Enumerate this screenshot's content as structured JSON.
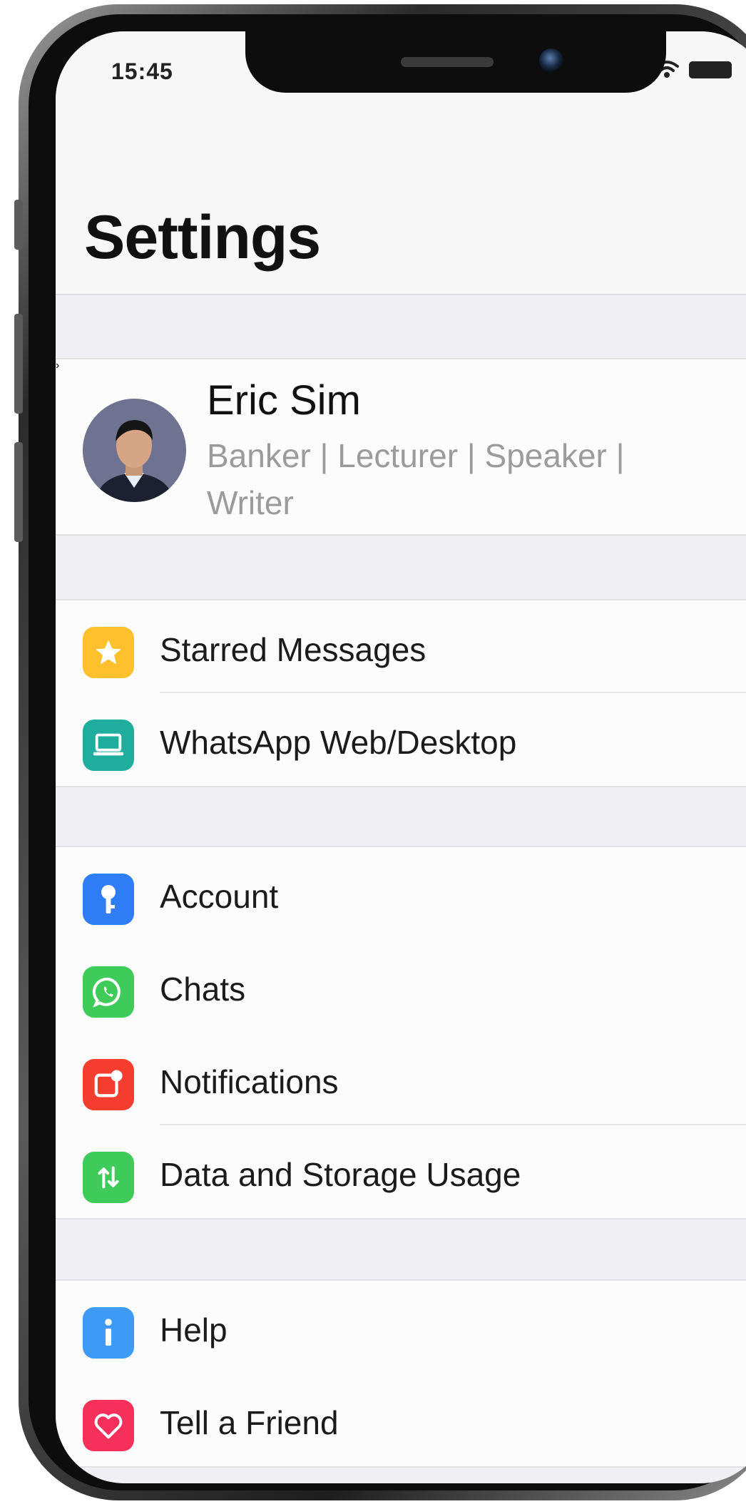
{
  "status_bar": {
    "time": "15:45"
  },
  "header": {
    "title": "Settings"
  },
  "profile": {
    "name": "Eric Sim",
    "status": "Banker | Lecturer | Speaker | Writer"
  },
  "groups": [
    {
      "items": [
        {
          "label": "Starred Messages",
          "icon": "star-icon",
          "color": "#FFC02E"
        },
        {
          "label": "WhatsApp Web/Desktop",
          "icon": "laptop-icon",
          "color": "#1FAE9E"
        }
      ]
    },
    {
      "items": [
        {
          "label": "Account",
          "icon": "key-icon",
          "color": "#2E7CF6"
        },
        {
          "label": "Chats",
          "icon": "whatsapp-icon",
          "color": "#3FCB59"
        },
        {
          "label": "Notifications",
          "icon": "notification-icon",
          "color": "#F43D2F"
        },
        {
          "label": "Data and Storage Usage",
          "icon": "data-arrows-icon",
          "color": "#3FCB59"
        }
      ]
    },
    {
      "items": [
        {
          "label": "Help",
          "icon": "info-icon",
          "color": "#3D9BF6"
        },
        {
          "label": "Tell a Friend",
          "icon": "heart-icon",
          "color": "#F5305A"
        }
      ]
    }
  ]
}
